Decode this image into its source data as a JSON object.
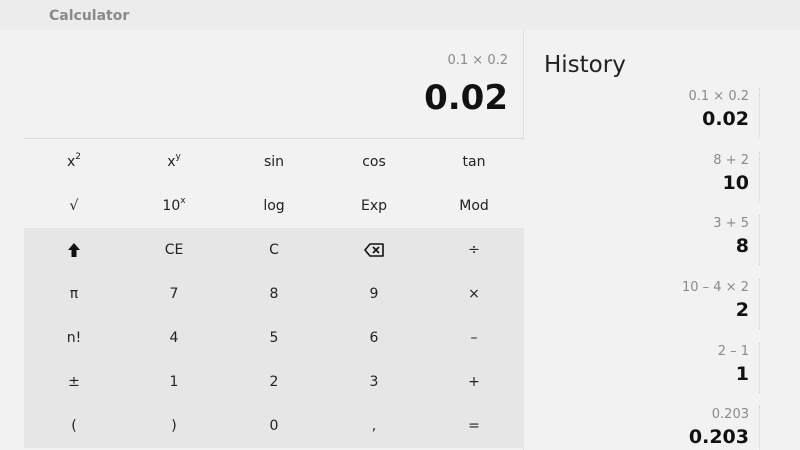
{
  "app": {
    "title": "Calculator"
  },
  "display": {
    "expression": "0.1 × 0.2",
    "result": "0.02"
  },
  "keys": {
    "square": "x",
    "square_sup": "2",
    "power": "x",
    "power_sup": "y",
    "sin": "sin",
    "cos": "cos",
    "tan": "tan",
    "sqrt": "√",
    "ten_pow": "10",
    "ten_pow_sup": "x",
    "log": "log",
    "exp": "Exp",
    "mod": "Mod",
    "shift": "🠕",
    "ce": "CE",
    "c": "C",
    "backspace": "⌫",
    "divide": "÷",
    "pi": "π",
    "seven": "7",
    "eight": "8",
    "nine": "9",
    "multiply": "×",
    "factorial": "n!",
    "four": "4",
    "five": "5",
    "six": "6",
    "minus": "–",
    "plusminus": "±",
    "one": "1",
    "two": "2",
    "three": "3",
    "plus": "+",
    "lparen": "(",
    "rparen": ")",
    "zero": "0",
    "decimal": ",",
    "equals": "="
  },
  "history": {
    "title": "History",
    "items": [
      {
        "expression": "0.1 × 0.2",
        "result": "0.02"
      },
      {
        "expression": "8 + 2",
        "result": "10"
      },
      {
        "expression": "3 + 5",
        "result": "8"
      },
      {
        "expression": "10 – 4 × 2",
        "result": "2"
      },
      {
        "expression": "2 – 1",
        "result": "1"
      },
      {
        "expression": "0.203",
        "result": "0.203"
      }
    ]
  }
}
